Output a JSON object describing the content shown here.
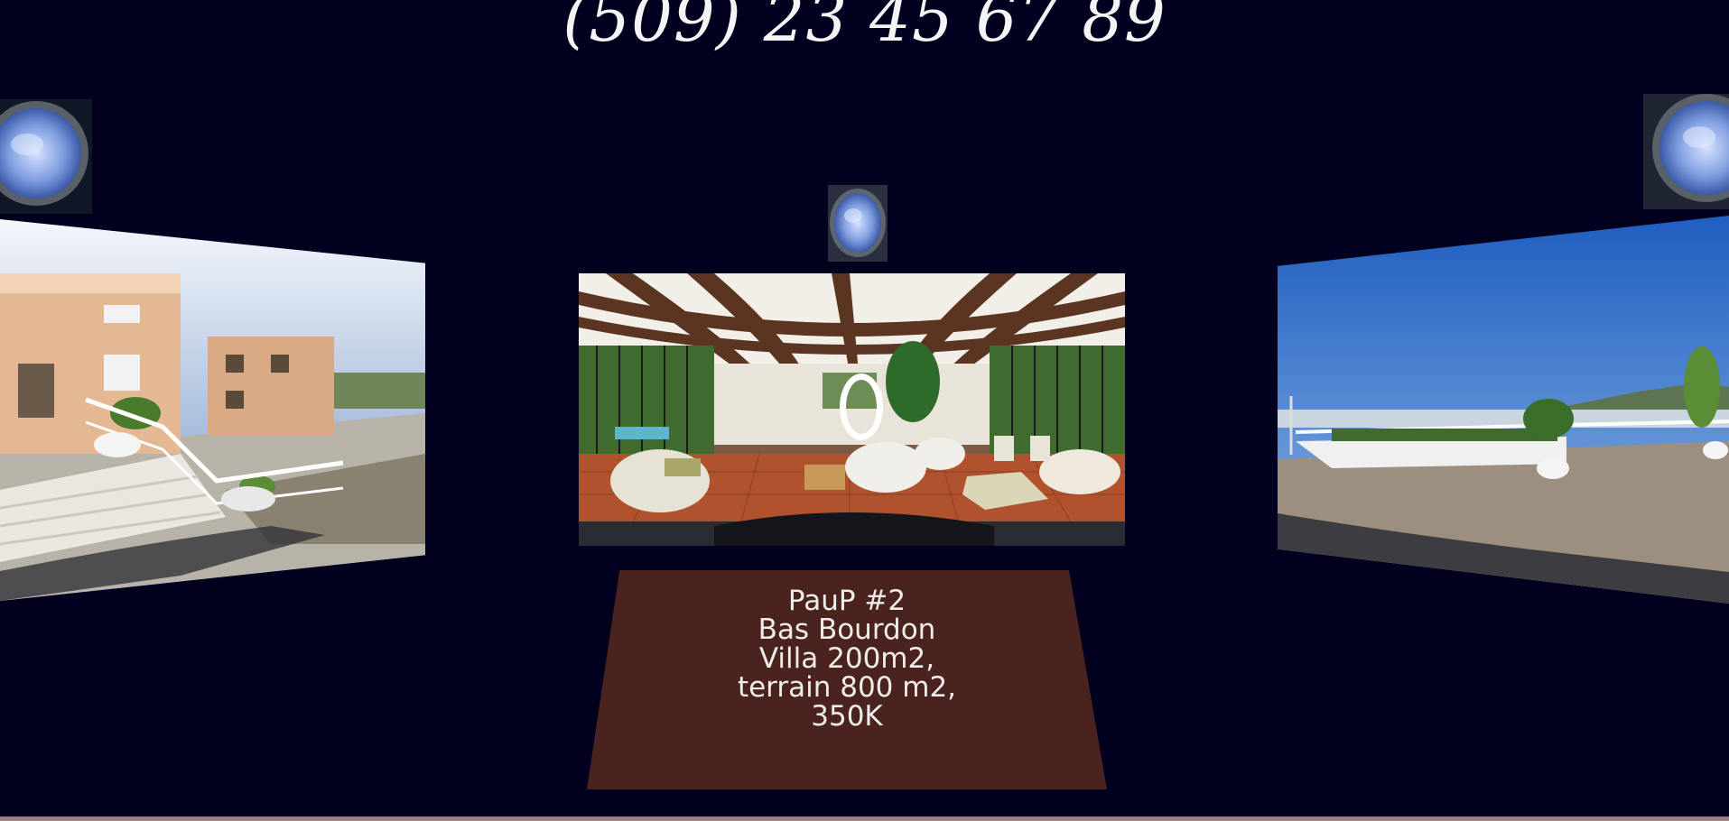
{
  "header": {
    "phone": "(509) 23 45 67 89"
  },
  "portals": [
    {
      "name": "portal-left",
      "icon": "stargate-portal-icon"
    },
    {
      "name": "portal-center",
      "icon": "stargate-portal-icon"
    },
    {
      "name": "portal-right",
      "icon": "stargate-portal-icon"
    }
  ],
  "scenes": {
    "left": {
      "icon": "villa-exterior-panorama"
    },
    "center": {
      "icon": "villa-living-room-panorama"
    },
    "right": {
      "icon": "terrace-view-panorama"
    }
  },
  "listing": {
    "line1": "PauP #2",
    "line2": "Bas Bourdon",
    "line3": "Villa 200m2,",
    "line4": "terrain 800 m2,",
    "line5": "350K"
  },
  "colors": {
    "background": "#02001f",
    "panel": "#4a231e",
    "hotspot": "#ffffff",
    "bottom_bar": "#9b7d82"
  }
}
